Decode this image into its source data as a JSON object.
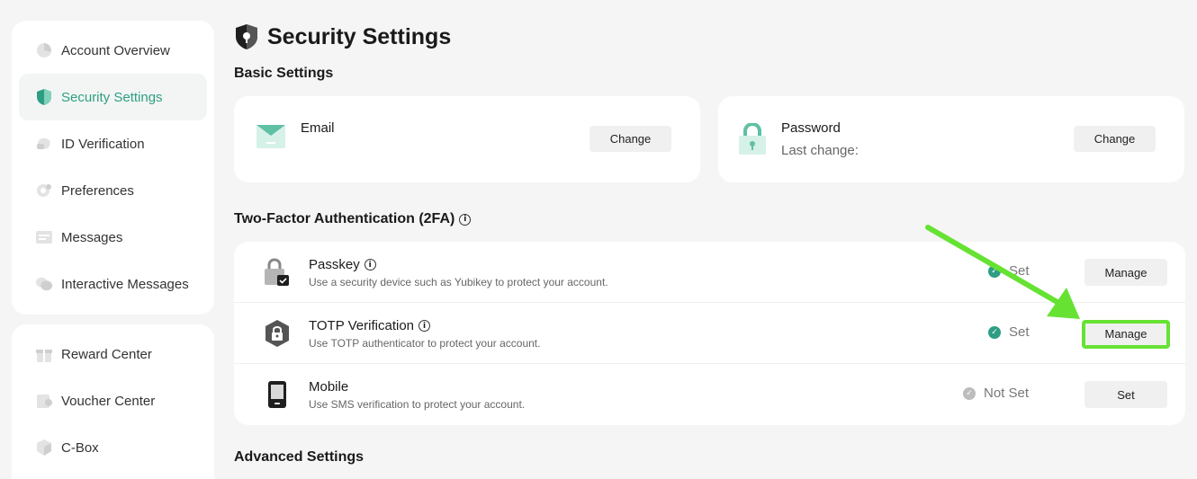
{
  "sidebar": {
    "top_items": [
      {
        "label": "Account Overview",
        "icon": "pie-chart-icon",
        "active": false
      },
      {
        "label": "Security Settings",
        "icon": "shield-icon",
        "active": true
      },
      {
        "label": "ID Verification",
        "icon": "id-card-icon",
        "active": false
      },
      {
        "label": "Preferences",
        "icon": "settings-icon",
        "active": false
      },
      {
        "label": "Messages",
        "icon": "message-icon",
        "active": false
      },
      {
        "label": "Interactive Messages",
        "icon": "chat-icon",
        "active": false
      }
    ],
    "bottom_items": [
      {
        "label": "Reward Center",
        "icon": "gift-icon"
      },
      {
        "label": "Voucher Center",
        "icon": "voucher-icon"
      },
      {
        "label": "C-Box",
        "icon": "box-icon"
      }
    ]
  },
  "page": {
    "title": "Security Settings",
    "title_icon": "shield-icon"
  },
  "basic": {
    "section_title": "Basic Settings",
    "email": {
      "label": "Email",
      "button": "Change",
      "icon": "envelope-icon"
    },
    "password": {
      "label": "Password",
      "sub": "Last change:",
      "button": "Change",
      "icon": "lock-icon"
    }
  },
  "tfa": {
    "section_title": "Two-Factor Authentication (2FA)",
    "info_glyph": "i",
    "rows": [
      {
        "name": "Passkey",
        "desc": "Use a security device such as Yubikey to protect your account.",
        "status": "Set",
        "button": "Manage",
        "icon": "passkey-icon"
      },
      {
        "name": "TOTP Verification",
        "desc": "Use TOTP authenticator to protect your account.",
        "status": "Set",
        "button": "Manage",
        "icon": "totp-lock-icon"
      },
      {
        "name": "Mobile",
        "desc": "Use SMS verification to protect your account.",
        "status": "Not Set",
        "button": "Set",
        "icon": "mobile-icon"
      }
    ]
  },
  "advanced": {
    "section_title": "Advanced Settings"
  },
  "colors": {
    "accent": "#2e9e83",
    "highlight": "#66e233",
    "status_set": "#2e9e83",
    "status_not_set": "#bdbdbd"
  },
  "glyphs": {
    "check": "✓"
  }
}
